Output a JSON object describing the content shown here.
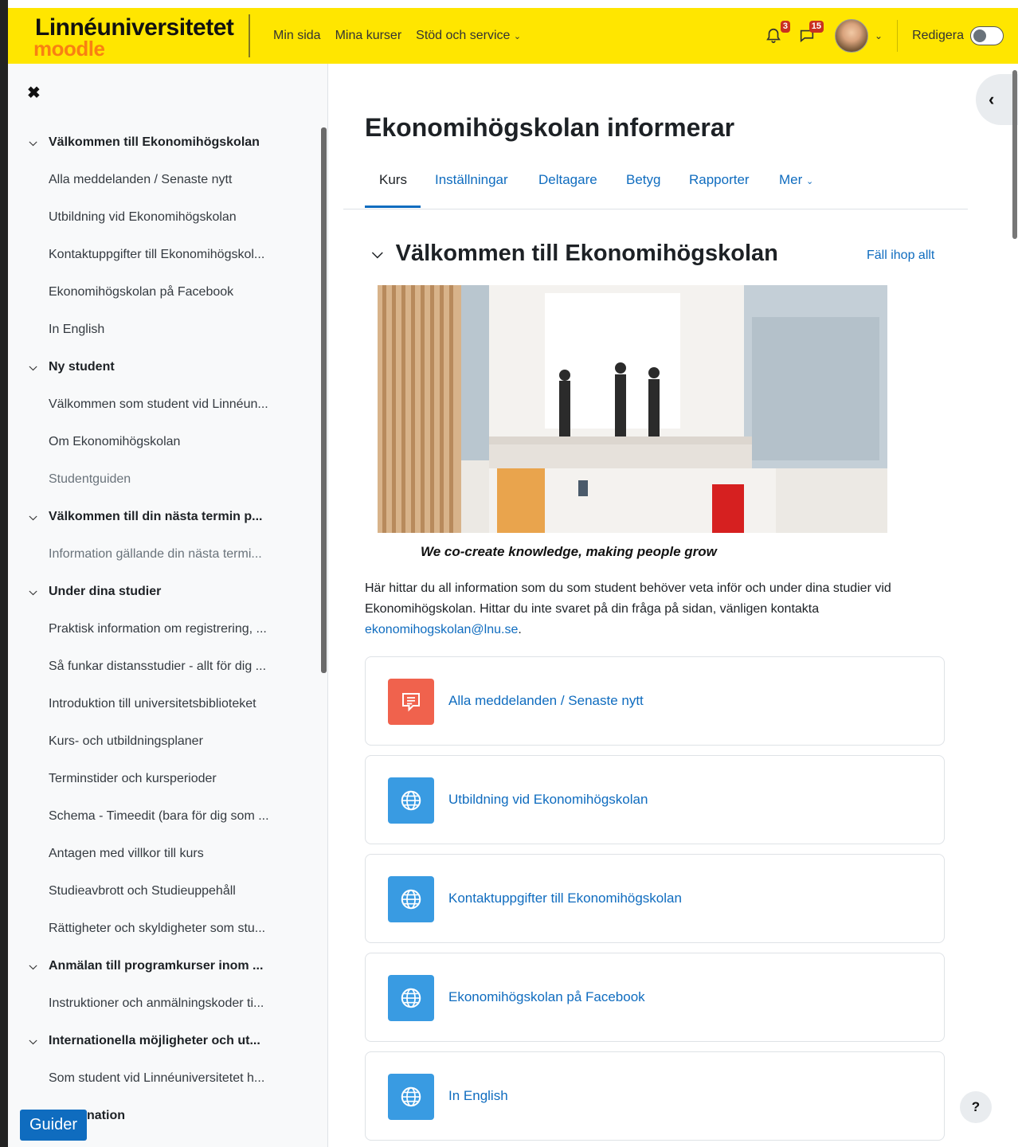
{
  "brand": {
    "line1": "Linnéuniversitetet",
    "line2": "moodle"
  },
  "nav": {
    "links": [
      "Min sida",
      "Mina kurser",
      "Stöd och service"
    ],
    "notifications_count": "3",
    "messages_count": "15",
    "edit_label": "Redigera"
  },
  "drawer": {
    "items": [
      {
        "label": "Välkommen till Ekonomihögskolan",
        "type": "section"
      },
      {
        "label": "Alla meddelanden / Senaste nytt",
        "type": "child"
      },
      {
        "label": "Utbildning vid Ekonomihögskolan",
        "type": "child"
      },
      {
        "label": "Kontaktuppgifter till Ekonomihögskol...",
        "type": "child"
      },
      {
        "label": "Ekonomihögskolan på Facebook",
        "type": "child"
      },
      {
        "label": "In English",
        "type": "child"
      },
      {
        "label": "Ny student",
        "type": "section"
      },
      {
        "label": "Välkommen som student vid Linnéun...",
        "type": "child"
      },
      {
        "label": "Om Ekonomihögskolan",
        "type": "child"
      },
      {
        "label": "Studentguiden",
        "type": "child-dim"
      },
      {
        "label": "Välkommen till din nästa termin p...",
        "type": "section"
      },
      {
        "label": "Information gällande din nästa termi...",
        "type": "child-dim"
      },
      {
        "label": "Under dina studier",
        "type": "section"
      },
      {
        "label": "Praktisk information om registrering, ...",
        "type": "child"
      },
      {
        "label": "Så funkar distansstudier - allt för dig ...",
        "type": "child"
      },
      {
        "label": "Introduktion till universitetsbiblioteket",
        "type": "child"
      },
      {
        "label": "Kurs- och utbildningsplaner",
        "type": "child"
      },
      {
        "label": "Terminstider och kursperioder",
        "type": "child"
      },
      {
        "label": "Schema - Timeedit (bara för dig som ...",
        "type": "child"
      },
      {
        "label": "Antagen med villkor till kurs",
        "type": "child"
      },
      {
        "label": "Studieavbrott och Studieuppehåll",
        "type": "child"
      },
      {
        "label": "Rättigheter och skyldigheter som stu...",
        "type": "child"
      },
      {
        "label": "Anmälan till programkurser inom ...",
        "type": "section"
      },
      {
        "label": "Instruktioner och anmälningskoder ti...",
        "type": "child"
      },
      {
        "label": "Internationella möjligheter och ut...",
        "type": "section"
      },
      {
        "label": "Som student vid Linnéuniversitetet h...",
        "type": "child"
      },
      {
        "label": "nation",
        "type": "section-nochev"
      }
    ],
    "guide_button": "Guider"
  },
  "main": {
    "title": "Ekonomihögskolan informerar",
    "tabs": [
      "Kurs",
      "Inställningar",
      "Deltagare",
      "Betyg",
      "Rapporter",
      "Mer"
    ],
    "section_title": "Välkommen till Ekonomihögskolan",
    "collapse_all": "Fäll ihop allt",
    "caption": "We co-create knowledge, making people grow",
    "intro_text": "Här hittar du all information som du som student behöver veta inför och under dina studier vid Ekonomihögskolan. Hittar du inte svaret på din fråga på sidan, vänligen kontakta ",
    "intro_email": "ekonomihogskolan@lnu.se",
    "intro_end": ".",
    "activities": [
      {
        "label": "Alla meddelanden / Senaste nytt",
        "icon": "forum-icon",
        "color": "#f0624d"
      },
      {
        "label": "Utbildning vid Ekonomihögskolan",
        "icon": "globe-icon",
        "color": "#399be2"
      },
      {
        "label": "Kontaktuppgifter till Ekonomihögskolan",
        "icon": "globe-icon",
        "color": "#399be2"
      },
      {
        "label": "Ekonomihögskolan på Facebook",
        "icon": "globe-icon",
        "color": "#399be2"
      },
      {
        "label": "In English",
        "icon": "globe-icon",
        "color": "#399be2"
      }
    ],
    "help_label": "?"
  },
  "colors": {
    "navbar": "#ffe600",
    "link": "#0f6cbf",
    "brand_orange": "#f98012"
  }
}
